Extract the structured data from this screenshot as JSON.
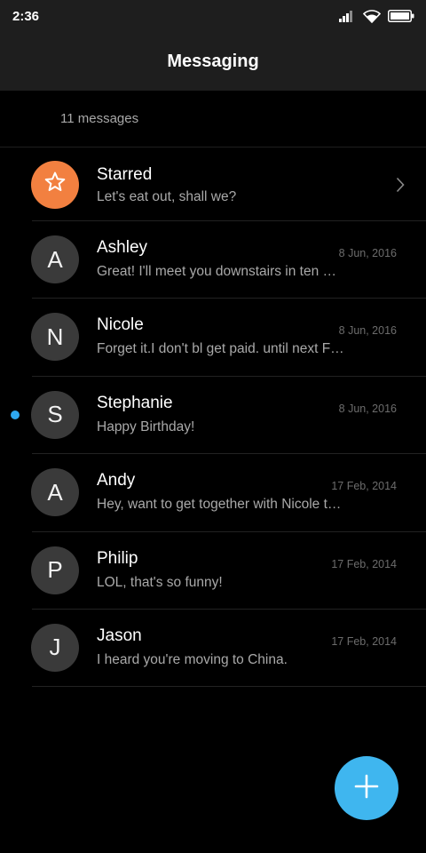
{
  "status_bar": {
    "time": "2:36",
    "icons": [
      "signal-icon",
      "wifi-icon",
      "battery-icon"
    ]
  },
  "header": {
    "title": "Messaging"
  },
  "summary": {
    "count_text": "11 messages"
  },
  "conversations": [
    {
      "avatar": "star-icon",
      "name": "Starred",
      "preview": "Let's eat out, shall we?",
      "date": "",
      "unread": false
    },
    {
      "avatar": "A",
      "name": "Ashley",
      "preview": "Great! I'll meet you downstairs in ten minutes.",
      "date": "8 Jun, 2016",
      "unread": false
    },
    {
      "avatar": "N",
      "name": "Nicole",
      "preview": "Forget it.I don't bl get paid. until next Friday.",
      "date": "8 Jun, 2016",
      "unread": false
    },
    {
      "avatar": "S",
      "name": "Stephanie",
      "preview": "Happy Birthday!",
      "date": "8 Jun, 2016",
      "unread": true
    },
    {
      "avatar": "A",
      "name": "Andy",
      "preview": "Hey, want to get together with Nicole tonight?",
      "date": "17 Feb, 2014",
      "unread": false
    },
    {
      "avatar": "P",
      "name": "Philip",
      "preview": "LOL, that's so funny!",
      "date": "17 Feb, 2014",
      "unread": false
    },
    {
      "avatar": "J",
      "name": "Jason",
      "preview": "I heard you're moving to China.",
      "date": "17 Feb, 2014",
      "unread": false
    }
  ],
  "fab": {
    "icon": "plus-icon"
  },
  "colors": {
    "background": "#000000",
    "bar": "#1e1e1e",
    "starred_avatar": "#f28040",
    "avatar": "#3a3a3a",
    "accent": "#3fb6ef",
    "unread_dot": "#2ea8f0"
  }
}
